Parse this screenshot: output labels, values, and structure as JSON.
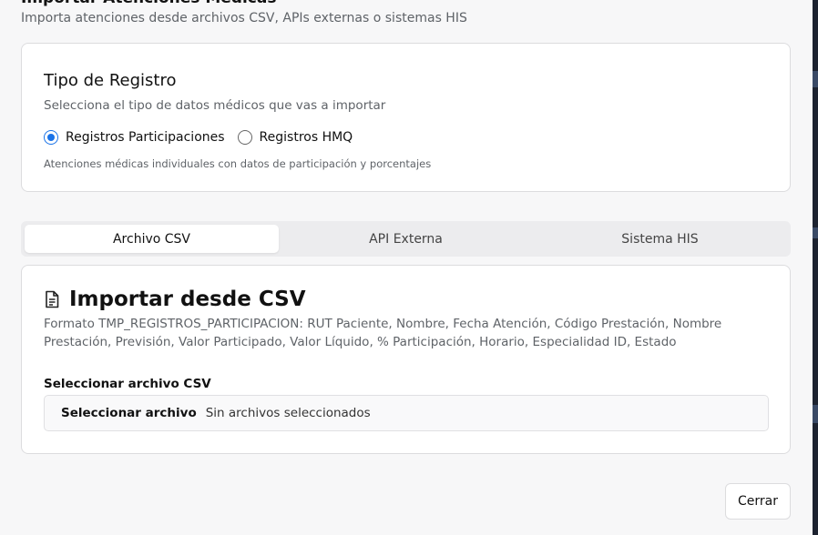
{
  "dialog": {
    "title": "Importar Atenciones Médicas",
    "subtitle": "Importa atenciones desde archivos CSV, APIs externas o sistemas HIS"
  },
  "record_type": {
    "title": "Tipo de Registro",
    "description": "Selecciona el tipo de datos médicos que vas a importar",
    "options": [
      {
        "label": "Registros Participaciones",
        "selected": true
      },
      {
        "label": "Registros HMQ",
        "selected": false
      }
    ],
    "help": "Atenciones médicas individuales con datos de participación y porcentajes"
  },
  "tabs": [
    {
      "label": "Archivo CSV",
      "active": true
    },
    {
      "label": "API Externa",
      "active": false
    },
    {
      "label": "Sistema HIS",
      "active": false
    }
  ],
  "csv": {
    "icon": "file-text-icon",
    "title": "Importar desde CSV",
    "format": "Formato TMP_REGISTROS_PARTICIPACION: RUT Paciente, Nombre, Fecha Atención, Código Prestación, Nombre Prestación, Previsión, Valor Participado, Valor Líquido, % Participación, Horario, Especialidad ID, Estado",
    "file_label": "Seleccionar archivo CSV",
    "file_button": "Seleccionar archivo",
    "file_status": "Sin archivos seleccionados"
  },
  "footer": {
    "close_label": "Cerrar"
  },
  "colors": {
    "accent": "#1a73e8",
    "background": "#f7f7f8",
    "card": "#ffffff"
  }
}
